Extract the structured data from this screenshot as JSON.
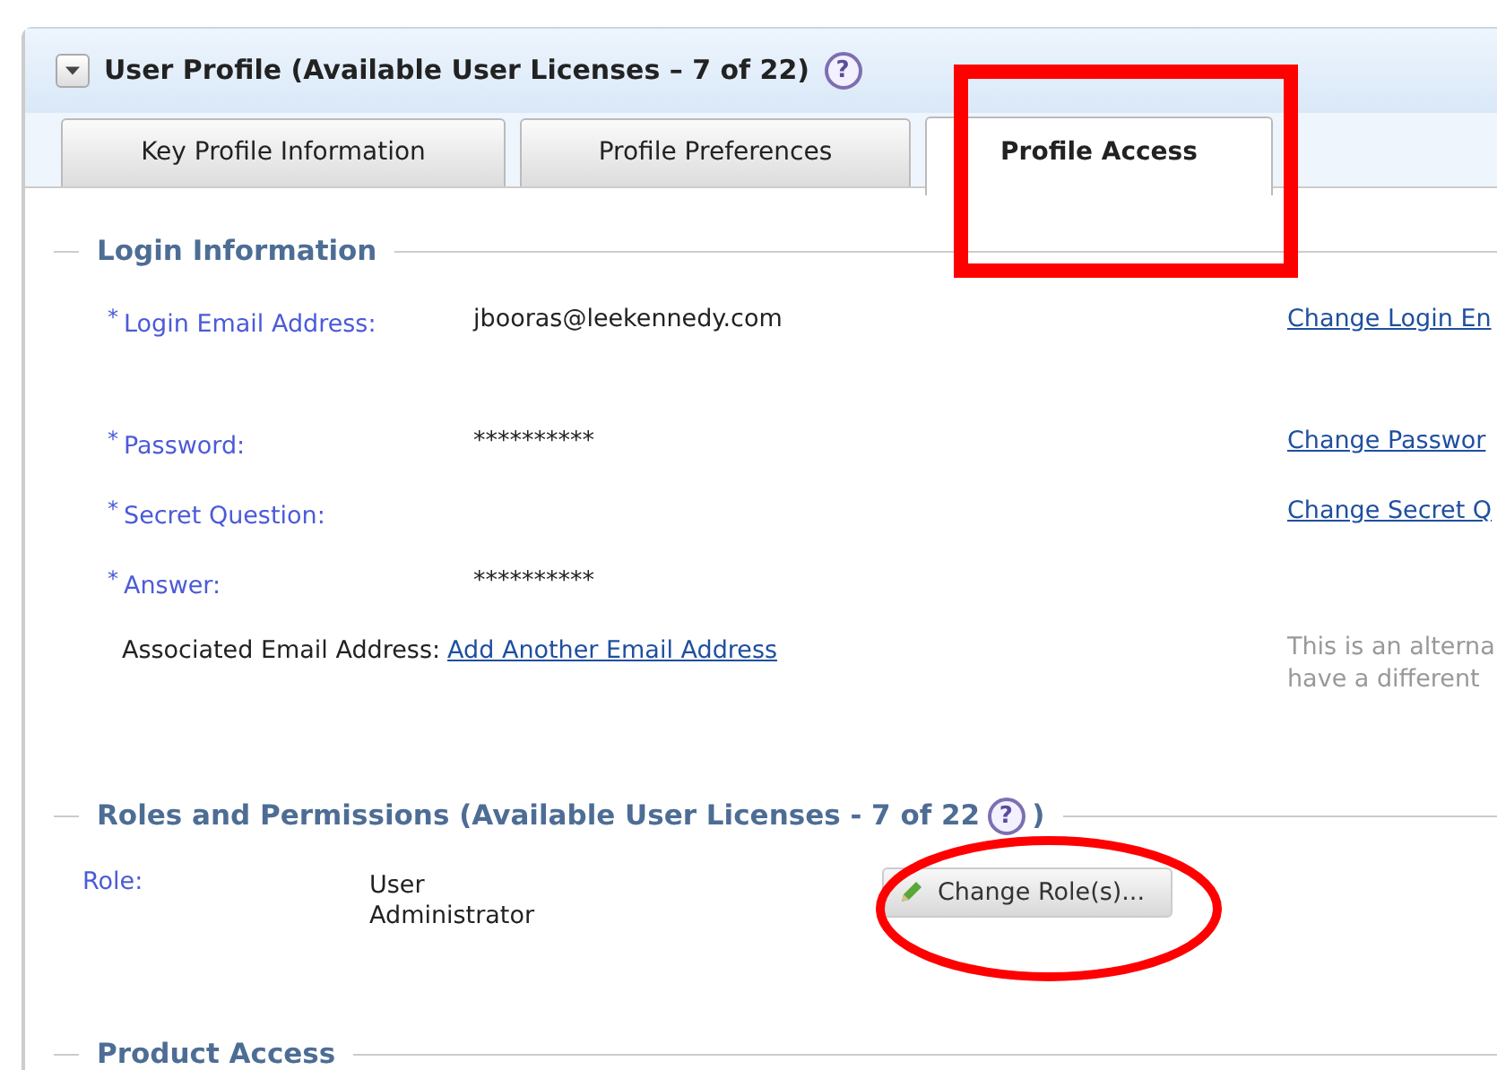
{
  "panel": {
    "title": "User Profile (Available User Licenses – 7 of 22)",
    "help": "?"
  },
  "tabs": [
    {
      "label": "Key Profile Information",
      "selected": false
    },
    {
      "label": "Profile Preferences",
      "selected": false
    },
    {
      "label": "Profile Access",
      "selected": true
    }
  ],
  "login_section": {
    "title": "Login Information",
    "rows": [
      {
        "kind": "required",
        "marker": "*",
        "label": "Login Email Address:",
        "value": "jbooras@leekennedy.com",
        "action": "Change Login En"
      },
      {
        "kind": "required",
        "marker": "*",
        "label": "Password:",
        "value": "**********",
        "action": "Change Passwor"
      },
      {
        "kind": "required",
        "marker": "*",
        "label": "Secret Question:",
        "action": "Change Secret Q"
      },
      {
        "kind": "required",
        "marker": "*",
        "label": "Answer:",
        "value": "**********"
      },
      {
        "kind": "optional",
        "label": "Associated Email Address:",
        "link": "Add Another Email Address",
        "note": [
          "This is an alterna",
          "have a different"
        ]
      }
    ]
  },
  "roles_section": {
    "title": "Roles and Permissions (Available User Licenses - 7 of 22",
    "help": "?",
    "title_end": ")",
    "role": {
      "label": "Role:",
      "value": "User Administrator",
      "button": "Change Role(s)..."
    }
  },
  "product_section": {
    "title": "Product Access"
  },
  "annotations": [
    {
      "color": "#ff0000"
    },
    {
      "color": "#ff0000"
    }
  ]
}
